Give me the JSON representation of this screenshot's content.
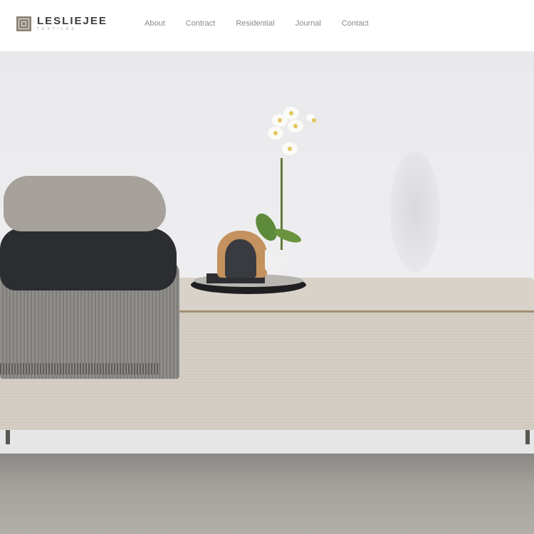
{
  "brand": {
    "name": "LESLIEJEE",
    "tagline": "TEXTILES",
    "logo_icon": "logo-mark-icon"
  },
  "nav": {
    "items": [
      {
        "label": "About"
      },
      {
        "label": "Contract"
      },
      {
        "label": "Residential"
      },
      {
        "label": "Journal"
      },
      {
        "label": "Contact"
      }
    ]
  },
  "colors": {
    "nav_text": "#8a8a8a",
    "logo_mark": "#8d857a",
    "header_bg": "#ffffff"
  }
}
